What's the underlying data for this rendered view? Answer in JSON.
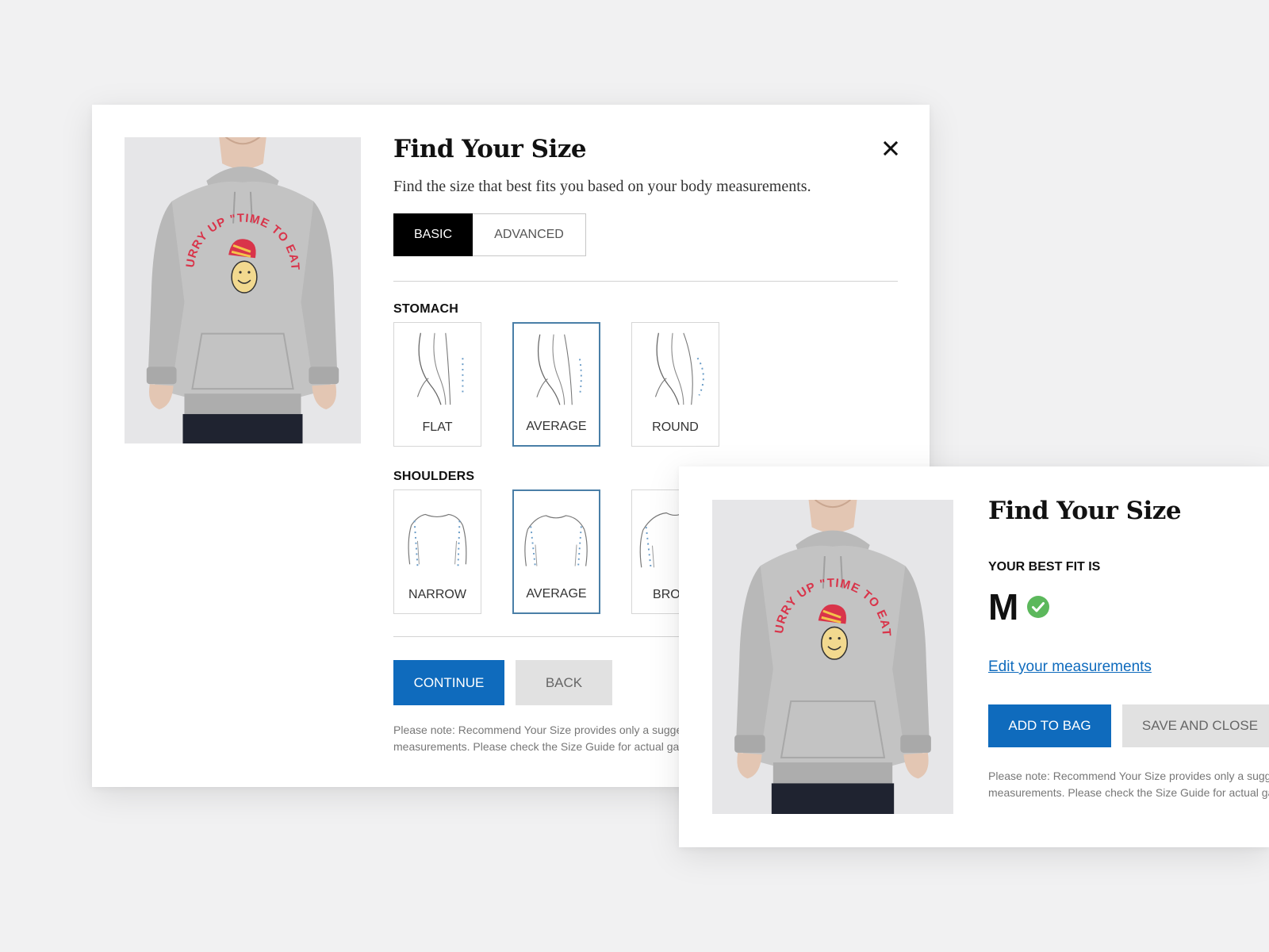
{
  "basic_modal": {
    "title": "Find Your Size",
    "subtitle": "Find the size that best fits you based on your body measurements.",
    "tabs": [
      {
        "label": "BASIC",
        "active": true
      },
      {
        "label": "ADVANCED",
        "active": false
      }
    ],
    "stomach": {
      "label": "STOMACH",
      "options": [
        "FLAT",
        "AVERAGE",
        "ROUND"
      ],
      "selected": "AVERAGE"
    },
    "shoulders": {
      "label": "SHOULDERS",
      "options": [
        "NARROW",
        "AVERAGE",
        "BROAD"
      ],
      "selected": "AVERAGE"
    },
    "continue_label": "CONTINUE",
    "back_label": "BACK",
    "note_line1": "Please note: Recommend Your Size provides only a suggestion based on your",
    "note_line2": "measurements. Please check the Size Guide for actual garment measurements."
  },
  "result_modal": {
    "title": "Find Your Size",
    "best_fit_label": "YOUR BEST FIT IS",
    "size": "M",
    "edit_link": "Edit your measurements",
    "add_to_bag_label": "ADD TO BAG",
    "save_close_label": "SAVE AND CLOSE",
    "note_line1": "Please note: Recommend Your Size provides only a suggestion based on your",
    "note_line2": "measurements. Please check the Size Guide for actual garment measurements."
  },
  "product_graphic": {
    "text": "CURRY UP \"TIME TO EAT\""
  },
  "colors": {
    "primary_blue": "#0f6bbd",
    "selected_border": "#4a7fa7",
    "check_green": "#5cb85c",
    "hoodie_grey": "#bdbdbd",
    "graphic_red": "#d9344a"
  },
  "icons": {
    "close": "close-icon",
    "check": "check-circle-icon"
  }
}
